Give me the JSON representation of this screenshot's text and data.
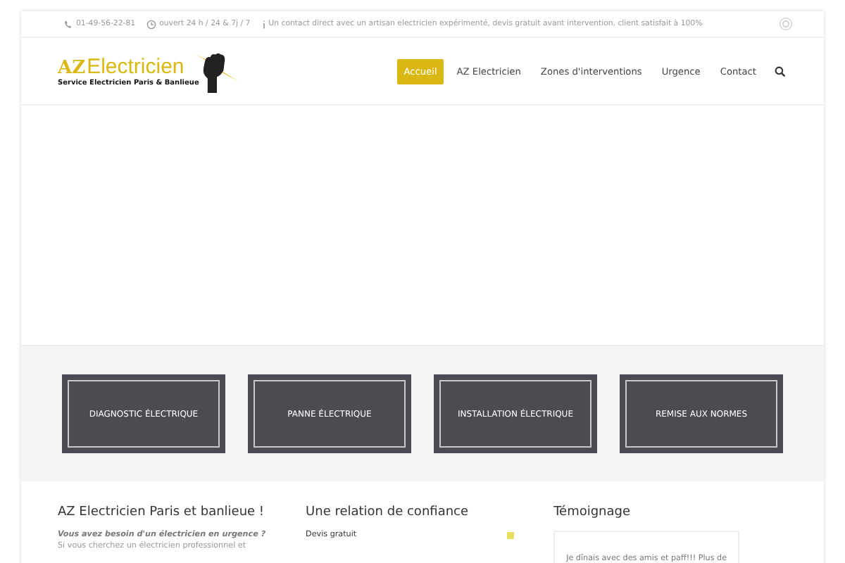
{
  "top_bar": {
    "items": [
      {
        "kind": "phone",
        "text": "01-49-56-22-81"
      },
      {
        "kind": "clock",
        "text": "ouvert 24 h / 24 & 7j / 7"
      },
      {
        "kind": "info",
        "text": "Un contact direct avec un artisan electricien expérimenté, devis gratuit avant intervention, client satisfait à 100%"
      }
    ]
  },
  "logo": {
    "brand_bold": "AZ",
    "brand_rest": "Electricien",
    "tagline": "Service Electricien Paris & Banlieue"
  },
  "nav": [
    {
      "label": "Accueil",
      "selected": true
    },
    {
      "label": "AZ Electricien",
      "selected": false
    },
    {
      "label": "Zones d'interventions",
      "selected": false
    },
    {
      "label": "Urgence",
      "selected": false
    },
    {
      "label": "Contact",
      "selected": false
    }
  ],
  "services": [
    {
      "label": "DIAGNOSTIC ÉLECTRIQUE"
    },
    {
      "label": "PANNE ÉLECTRIQUE"
    },
    {
      "label": "INSTALLATION ÉLECTRIQUE"
    },
    {
      "label": "REMISE AUX NORMES"
    }
  ],
  "columns": [
    {
      "kind": "text",
      "title": "AZ Electricien Paris et banlieue !",
      "lead": "Vous avez besoin d'un électricien en urgence ?",
      "body": "Si vous cherchez un électricien professionnel et"
    },
    {
      "kind": "accordion",
      "title": "Une relation de confiance",
      "item": "Devis gratuit"
    },
    {
      "kind": "quote",
      "title": "Témoignage",
      "quote": "Je dînais avec des amis et paff!!! Plus de"
    }
  ]
}
